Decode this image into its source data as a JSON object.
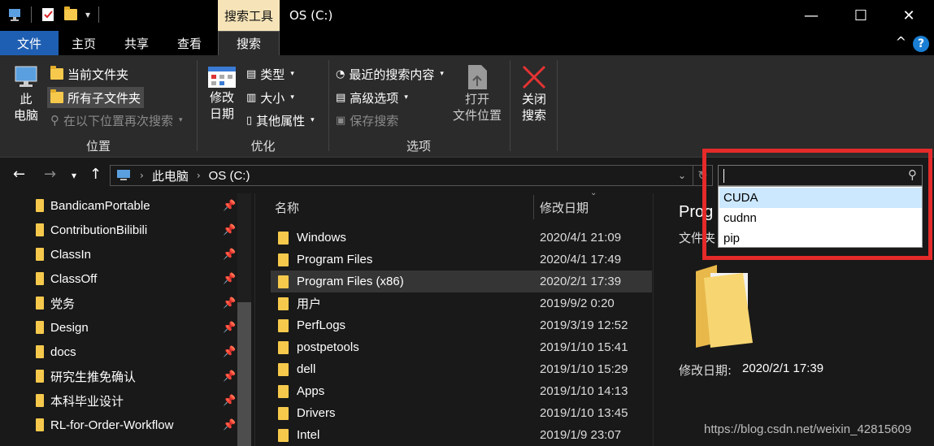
{
  "titlebar": {
    "context_tab": "搜索工具",
    "title": "OS (C:)",
    "minimize": "—",
    "maximize": "☐",
    "close": "✕"
  },
  "tabs": {
    "file": "文件",
    "home": "主页",
    "share": "共享",
    "view": "查看",
    "search": "搜索"
  },
  "ribbon": {
    "location": {
      "this_pc_line1": "此",
      "this_pc_line2": "电脑",
      "current_folder": "当前文件夹",
      "all_subfolders": "所有子文件夹",
      "search_again": "在以下位置再次搜索",
      "label": "位置"
    },
    "refine": {
      "date_modified_line1": "修改",
      "date_modified_line2": "日期",
      "kind": "类型",
      "size": "大小",
      "other_properties": "其他属性",
      "label": "优化"
    },
    "options": {
      "recent_searches": "最近的搜索内容",
      "advanced_options": "高级选项",
      "save_search": "保存搜索",
      "open_location_line1": "打开",
      "open_location_line2": "文件位置",
      "label": "选项"
    },
    "close": {
      "line1": "关闭",
      "line2": "搜索"
    }
  },
  "address": {
    "this_pc": "此电脑",
    "drive": "OS (C:)"
  },
  "search": {
    "suggestions": [
      "CUDA",
      "cudnn",
      "pip"
    ]
  },
  "nav_pane": {
    "items": [
      "BandicamPortable",
      "ContributionBilibili",
      "ClassIn",
      "ClassOff",
      "党务",
      "Design",
      "docs",
      "研究生推免确认",
      "本科毕业设计",
      "RL-for-Order-Workflow"
    ]
  },
  "file_list": {
    "col_name": "名称",
    "col_date": "修改日期",
    "rows": [
      {
        "name": "Windows",
        "date": "2020/4/1 21:09"
      },
      {
        "name": "Program Files",
        "date": "2020/4/1 17:49"
      },
      {
        "name": "Program Files (x86)",
        "date": "2020/2/1 17:39"
      },
      {
        "name": "用户",
        "date": "2019/9/2 0:20"
      },
      {
        "name": "PerfLogs",
        "date": "2019/3/19 12:52"
      },
      {
        "name": "postpetools",
        "date": "2019/1/10 15:41"
      },
      {
        "name": "dell",
        "date": "2019/1/10 15:29"
      },
      {
        "name": "Apps",
        "date": "2019/1/10 14:13"
      },
      {
        "name": "Drivers",
        "date": "2019/1/10 13:45"
      },
      {
        "name": "Intel",
        "date": "2019/1/9 23:07"
      }
    ]
  },
  "preview": {
    "name": "Prog",
    "type": "文件夹",
    "date_label": "修改日期:",
    "date_value": "2020/2/1 17:39"
  },
  "watermark": "https://blog.csdn.net/weixin_42815609",
  "colors": {
    "file_tab": "#1f5fb3",
    "context_tab": "#f6e4b8",
    "annotation_frame": "#e52a2a",
    "dropdown_selected": "#cce8ff",
    "folder": "#f6c94c"
  }
}
